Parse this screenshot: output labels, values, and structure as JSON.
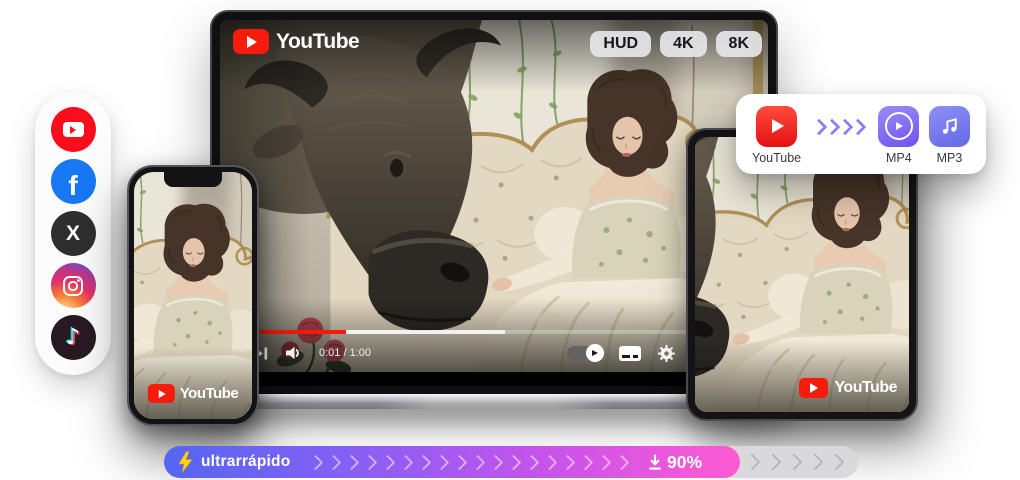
{
  "social_rail": {
    "platforms": [
      {
        "name": "YouTube",
        "icon": "youtube-icon",
        "color": "#FC0D1B"
      },
      {
        "name": "Facebook",
        "icon": "facebook-icon",
        "color": "#1877F2",
        "glyph": "f"
      },
      {
        "name": "X",
        "icon": "x-icon",
        "color": "#2F2F2F",
        "glyph": "X"
      },
      {
        "name": "Instagram",
        "icon": "instagram-icon"
      },
      {
        "name": "TikTok",
        "icon": "tiktok-icon",
        "color": "#281A22",
        "glyph": "♪"
      }
    ]
  },
  "player": {
    "brand": "YouTube",
    "badges": [
      "HUD",
      "4K",
      "8K"
    ],
    "time": "0:01 / 1:00"
  },
  "devices": {
    "phone_brand": "YouTube",
    "tablet_brand": "YouTube"
  },
  "convert_card": {
    "source_label": "YouTube",
    "targets": [
      {
        "label": "MP4"
      },
      {
        "label": "MP3"
      }
    ]
  },
  "banner": {
    "speed_label": "ultrarrápido",
    "progress_label": "90%"
  },
  "colors": {
    "youtube_red": "#F61C0D",
    "facebook_blue": "#1877F2",
    "x_black": "#2F2F2F",
    "tiktok_cyan": "#25F4EE",
    "tiktok_red": "#FE2C55",
    "mp4_purple": "#6E52EE",
    "mp3_violet": "#6468E6",
    "banner_gradient": [
      "#5366F2",
      "#8A5FF4",
      "#C653EA",
      "#FF5BD3"
    ],
    "bolt_yellow": "#FFD21E",
    "progress_red": "#F21D0D"
  }
}
